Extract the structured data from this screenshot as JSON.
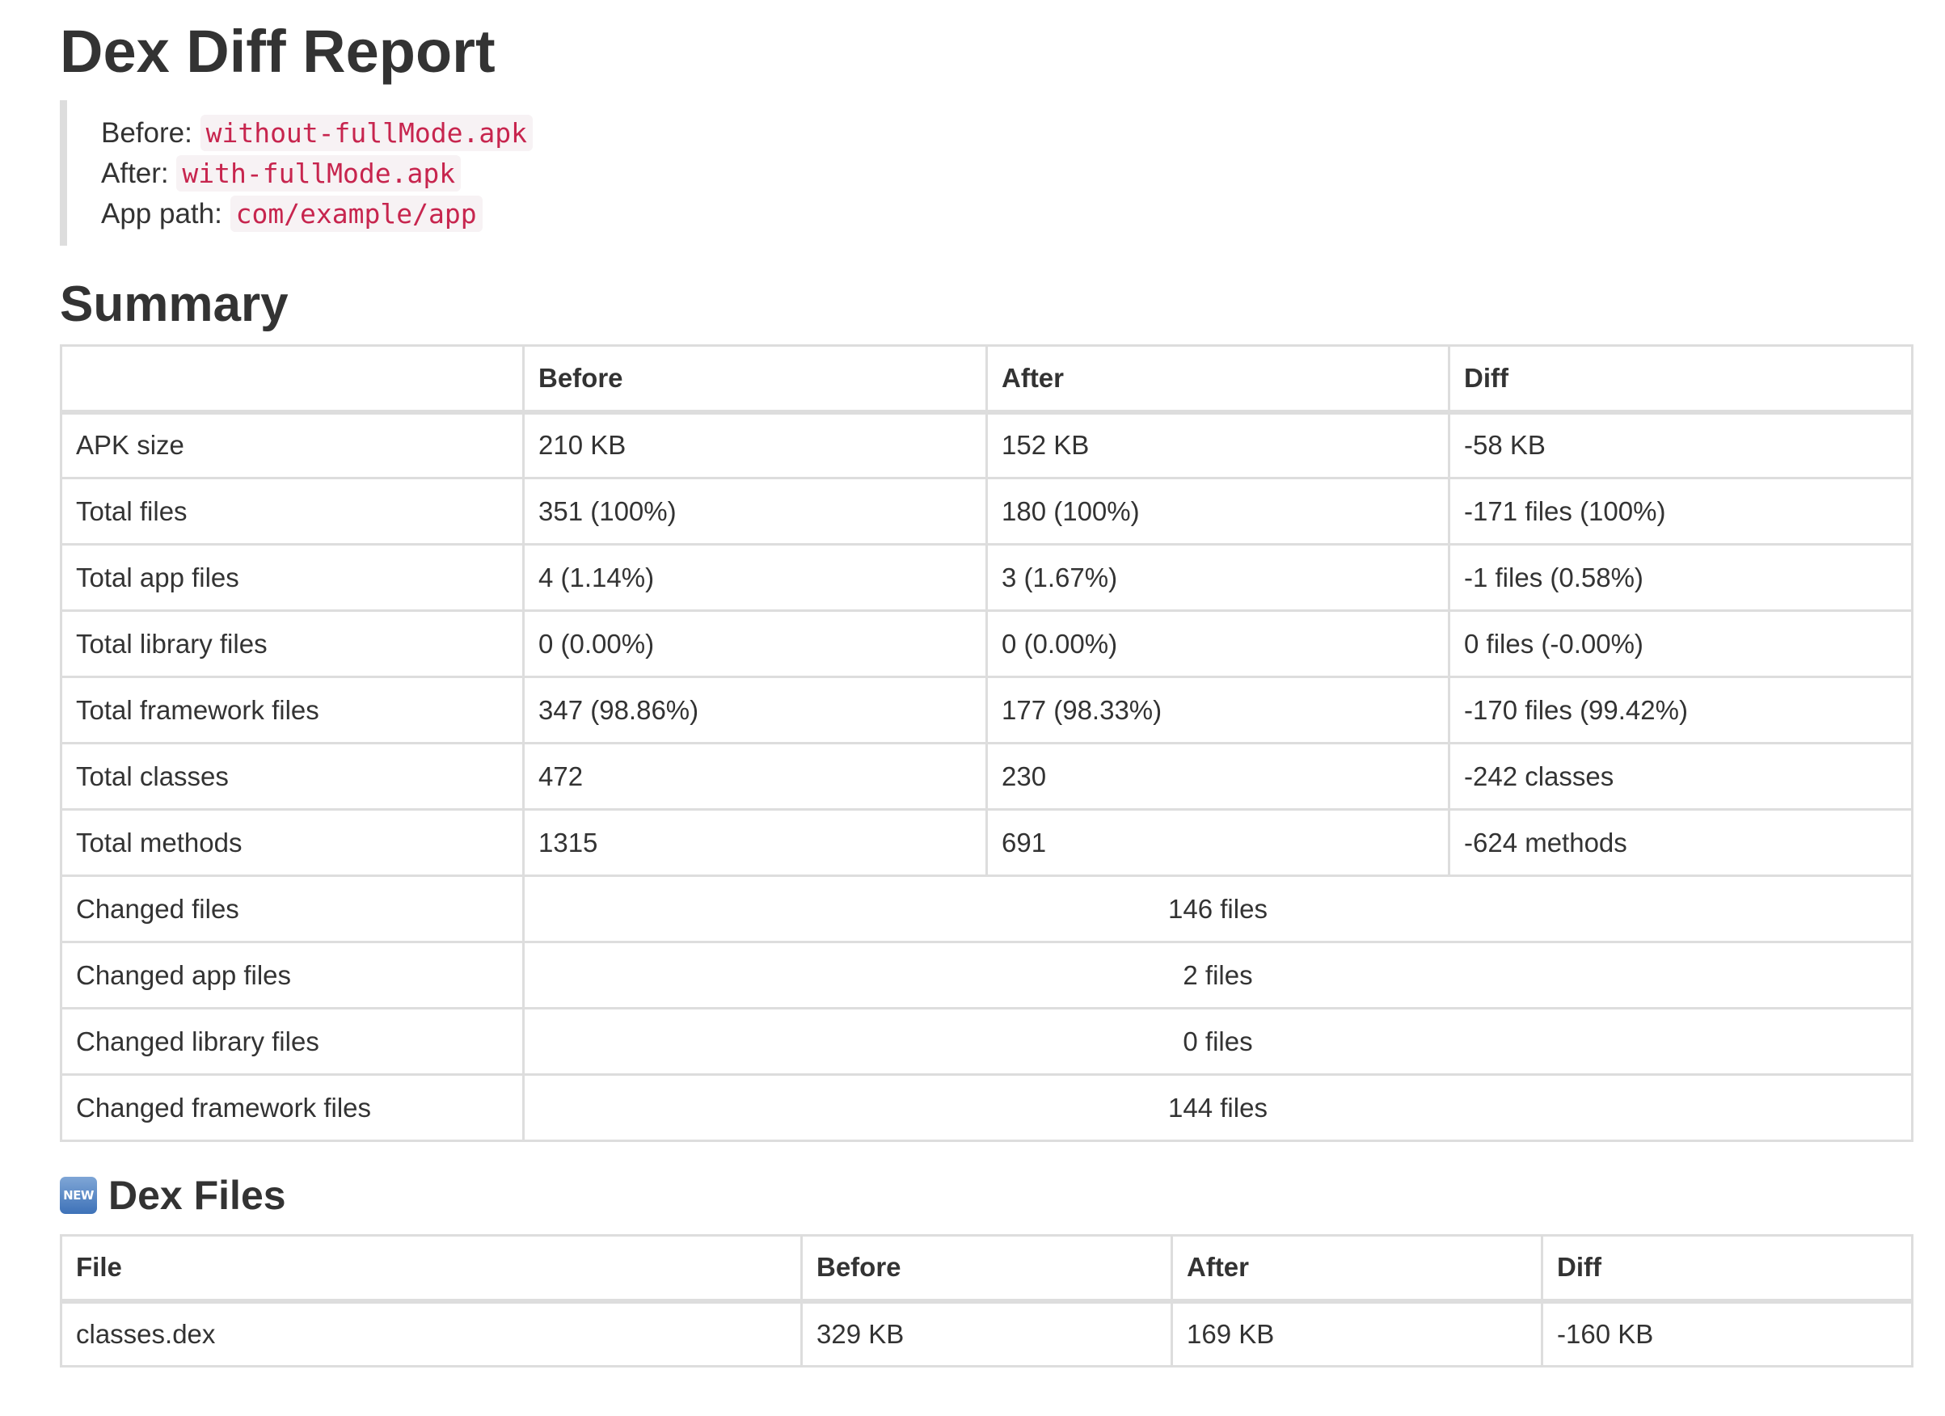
{
  "title": "Dex Diff Report",
  "meta": {
    "before_label": "Before:",
    "before_value": "without-fullMode.apk",
    "after_label": "After:",
    "after_value": "with-fullMode.apk",
    "app_path_label": "App path:",
    "app_path_value": "com/example/app"
  },
  "summary": {
    "heading": "Summary",
    "columns": [
      "",
      "Before",
      "After",
      "Diff"
    ],
    "rows": [
      [
        "APK size",
        "210 KB",
        "152 KB",
        "-58 KB"
      ],
      [
        "Total files",
        "351 (100%)",
        "180 (100%)",
        "-171 files (100%)"
      ],
      [
        "Total app files",
        "4 (1.14%)",
        "3 (1.67%)",
        "-1 files (0.58%)"
      ],
      [
        "Total library files",
        "0 (0.00%)",
        "0 (0.00%)",
        "0 files (-0.00%)"
      ],
      [
        "Total framework files",
        "347 (98.86%)",
        "177 (98.33%)",
        "-170 files (99.42%)"
      ],
      [
        "Total classes",
        "472",
        "230",
        "-242 classes"
      ],
      [
        "Total methods",
        "1315",
        "691",
        "-624 methods"
      ]
    ],
    "merged_rows": [
      [
        "Changed files",
        "146 files"
      ],
      [
        "Changed app files",
        "2 files"
      ],
      [
        "Changed library files",
        "0 files"
      ],
      [
        "Changed framework files",
        "144 files"
      ]
    ]
  },
  "dex_files": {
    "badge": "NEW",
    "badge_icon": "new-badge-icon",
    "heading": "Dex Files",
    "columns": [
      "File",
      "Before",
      "After",
      "Diff"
    ],
    "rows": [
      [
        "classes.dex",
        "329 KB",
        "169 KB",
        "-160 KB"
      ]
    ]
  }
}
